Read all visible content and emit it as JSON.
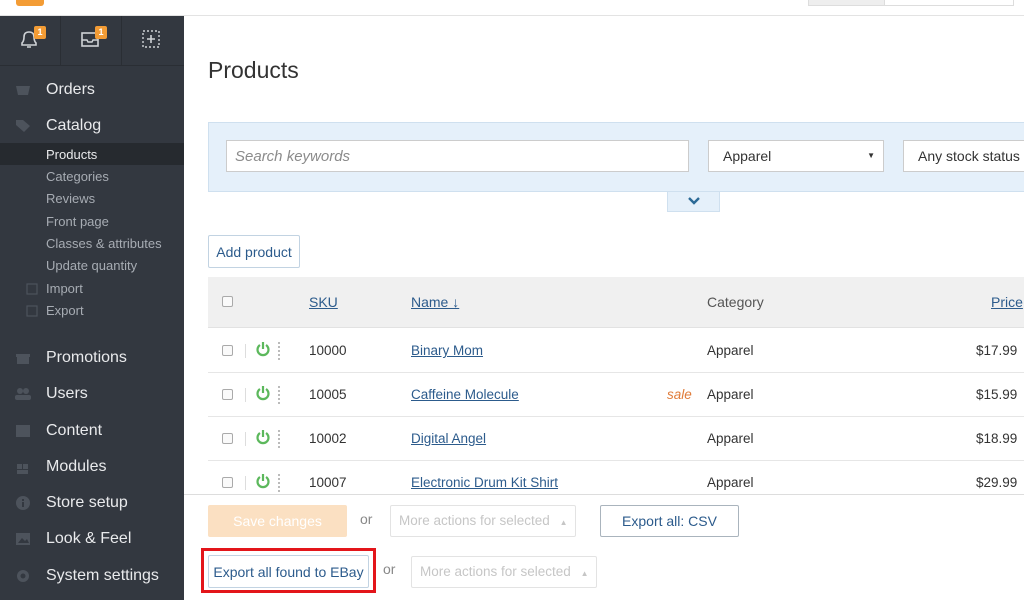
{
  "colors": {
    "sidebar_bg": "#333840",
    "accent": "#f39c35",
    "link": "#2c5b8c",
    "sale": "#e07b39",
    "highlight": "#e3151a",
    "power_green": "#5cb85c"
  },
  "header": {
    "notifications_badge": "1",
    "orders_badge": "1",
    "icons": [
      "bell-icon",
      "inbox-icon",
      "add-icon"
    ]
  },
  "sidebar": {
    "main_items": [
      {
        "label": "Orders",
        "icon": "cart-icon"
      },
      {
        "label": "Catalog",
        "icon": "tag-icon"
      },
      {
        "label": "Promotions",
        "icon": "gift-icon"
      },
      {
        "label": "Users",
        "icon": "users-icon"
      },
      {
        "label": "Content",
        "icon": "content-icon"
      },
      {
        "label": "Modules",
        "icon": "puzzle-icon"
      },
      {
        "label": "Store setup",
        "icon": "info-icon"
      },
      {
        "label": "Look & Feel",
        "icon": "image-icon"
      },
      {
        "label": "System settings",
        "icon": "gear-icon"
      }
    ],
    "catalog_items": [
      {
        "label": "Products",
        "active": true
      },
      {
        "label": "Categories"
      },
      {
        "label": "Reviews"
      },
      {
        "label": "Front page"
      },
      {
        "label": "Classes & attributes"
      },
      {
        "label": "Update quantity"
      },
      {
        "label": "Import",
        "icon": "import-icon"
      },
      {
        "label": "Export",
        "icon": "export-icon"
      }
    ]
  },
  "main": {
    "title": "Products",
    "search": {
      "placeholder": "Search keywords",
      "value": ""
    },
    "category_select": "Apparel",
    "stock_select": "Any stock status",
    "add_button": "Add product",
    "table": {
      "headers": {
        "sku": "SKU",
        "name": "Name ↓",
        "category": "Category",
        "price": "Price"
      },
      "rows": [
        {
          "sku": "10000",
          "name": "Binary Mom",
          "sale": "",
          "category": "Apparel",
          "price": "$17.99"
        },
        {
          "sku": "10005",
          "name": "Caffeine Molecule",
          "sale": "sale",
          "category": "Apparel",
          "price": "$15.99"
        },
        {
          "sku": "10002",
          "name": "Digital Angel",
          "sale": "",
          "category": "Apparel",
          "price": "$18.99"
        },
        {
          "sku": "10007",
          "name": "Electronic Drum Kit Shirt",
          "sale": "",
          "category": "Apparel",
          "price": "$29.99"
        }
      ]
    }
  },
  "bottom": {
    "save_label": "Save changes",
    "or_label": "or",
    "more_actions_label": "More actions for selected",
    "export_csv_label": "Export all: CSV",
    "ebay_label": "Export all found to EBay"
  }
}
